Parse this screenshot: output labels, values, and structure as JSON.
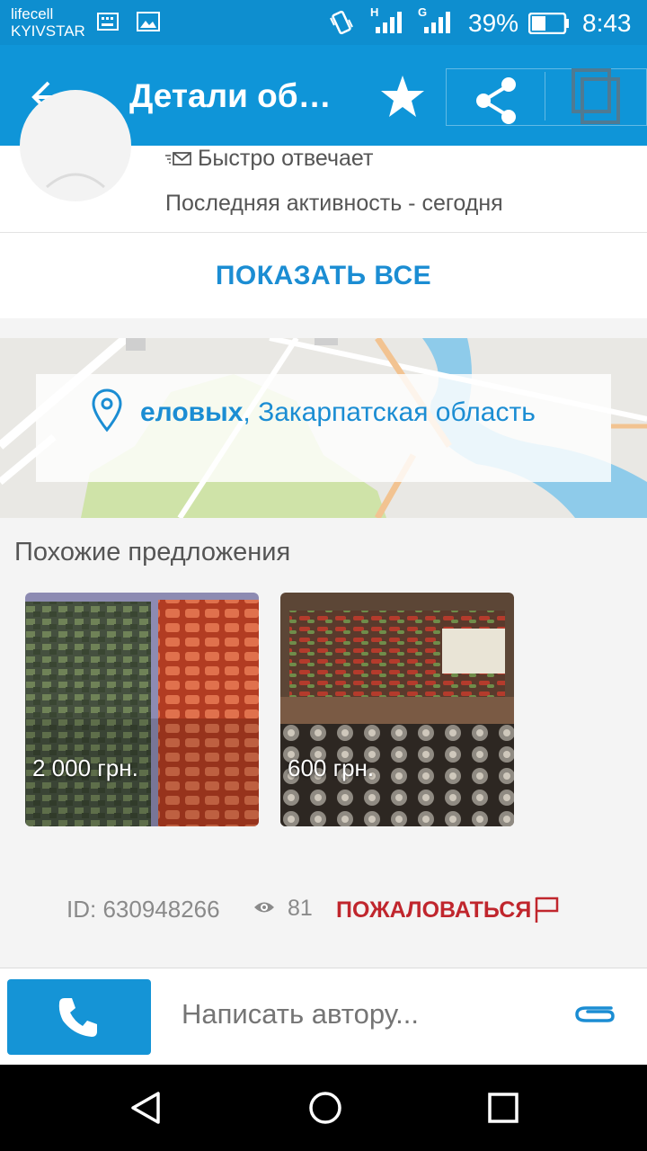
{
  "status_bar": {
    "carrier_1": "lifecell",
    "carrier_2": "KYIVSTAR",
    "net_1": "H",
    "net_2": "G",
    "battery": "39%",
    "time": "8:43"
  },
  "app_bar": {
    "title": "Детали об…"
  },
  "seller": {
    "responds": "Быстро отвечает",
    "activity": "Последняя активность - сегодня",
    "show_all": "ПОКАЗАТЬ ВСЕ"
  },
  "location": {
    "city": "еловых",
    "region": ", Закарпатская область"
  },
  "similar": {
    "title": "Похожие предложения",
    "offers": [
      {
        "price": "2 000 грн."
      },
      {
        "price": "600 грн."
      }
    ]
  },
  "meta": {
    "id": "ID: 630948266",
    "views": "81",
    "report": "ПОЖАЛОВАТЬСЯ"
  },
  "action_bar": {
    "message_placeholder": "Написать автору..."
  },
  "colors": {
    "primary": "#0f95d8",
    "accent": "#1b8dd3",
    "report": "#c0262d"
  }
}
